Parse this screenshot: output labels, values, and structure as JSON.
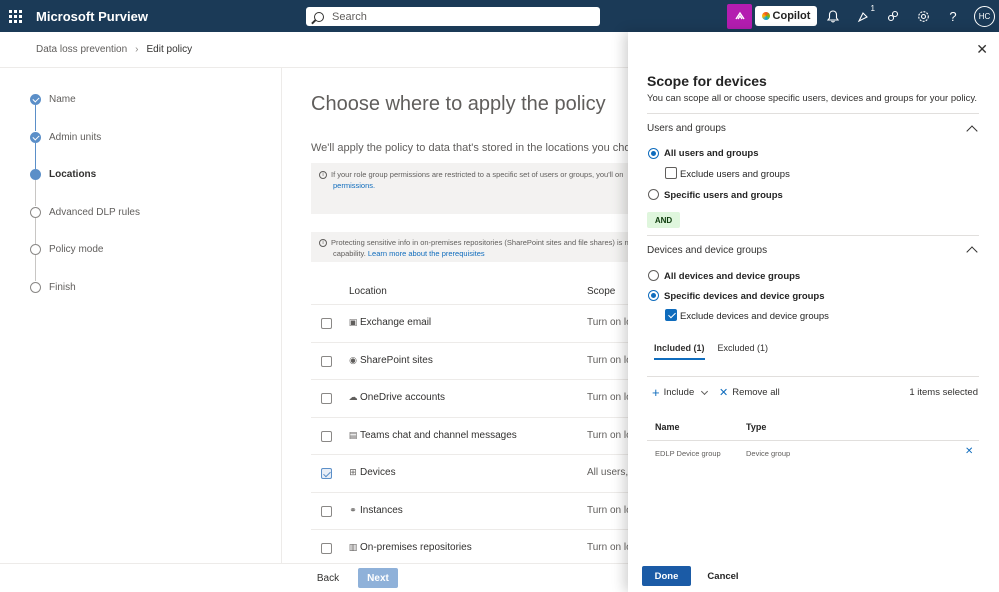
{
  "app": {
    "name": "Microsoft Purview"
  },
  "topbar": {
    "search_placeholder": "Search",
    "copilot_label": "Copilot",
    "notification_count": "1",
    "avatar_initials": "HC",
    "icons": [
      "waffle-icon",
      "purview-icon",
      "bell-icon",
      "link-icon",
      "gear-icon",
      "help-icon"
    ]
  },
  "breadcrumb": {
    "parent": "Data loss prevention",
    "current": "Edit policy"
  },
  "steps": [
    {
      "label": "Name",
      "state": "done"
    },
    {
      "label": "Admin units",
      "state": "done"
    },
    {
      "label": "Locations",
      "state": "active"
    },
    {
      "label": "Advanced DLP rules",
      "state": "pending"
    },
    {
      "label": "Policy mode",
      "state": "pending"
    },
    {
      "label": "Finish",
      "state": "pending"
    }
  ],
  "main": {
    "title": "Choose where to apply the policy",
    "description": "We'll apply the policy to data that's stored in the locations you choose.",
    "info1_line1": "If your role group permissions are restricted to a specific set of users or groups, you'll on",
    "info1_link": "permissions.",
    "info2_line1": "Protecting sensitive info in on-premises repositories (SharePoint sites and file shares) is n",
    "info2_line2": "capability.",
    "info2_link": "Learn more about the prerequisites",
    "table": {
      "col_location": "Location",
      "col_scope": "Scope",
      "rows": [
        {
          "name": "Exchange email",
          "scope": "Turn on lo",
          "checked": false,
          "icon": "exchange-icon"
        },
        {
          "name": "SharePoint sites",
          "scope": "Turn on lo",
          "checked": false,
          "icon": "sharepoint-icon"
        },
        {
          "name": "OneDrive accounts",
          "scope": "Turn on lo",
          "checked": false,
          "icon": "onedrive-icon"
        },
        {
          "name": "Teams chat and channel messages",
          "scope": "Turn on lo",
          "checked": false,
          "icon": "teams-icon"
        },
        {
          "name": "Devices",
          "scope": "All users, g",
          "checked": true,
          "icon": "windows-icon"
        },
        {
          "name": "Instances",
          "scope": "Turn on lo",
          "checked": false,
          "icon": "instances-icon"
        },
        {
          "name": "On-premises repositories",
          "scope": "Turn on lo",
          "checked": false,
          "icon": "server-icon"
        }
      ]
    },
    "back_label": "Back",
    "next_label": "Next"
  },
  "panel": {
    "title": "Scope for devices",
    "description": "You can scope all or choose specific users, devices and groups for your policy.",
    "users_section": {
      "title": "Users and groups",
      "opt_all": "All users and groups",
      "exclude": "Exclude users and groups",
      "opt_specific": "Specific users and groups"
    },
    "and_label": "AND",
    "devices_section": {
      "title": "Devices and device groups",
      "opt_all": "All devices and device groups",
      "opt_specific": "Specific devices and device groups",
      "exclude": "Exclude devices and device groups"
    },
    "tabs": {
      "included": "Included (1)",
      "excluded": "Excluded (1)"
    },
    "toolbar": {
      "include": "Include",
      "remove_all": "Remove all",
      "selected": "1 items selected"
    },
    "table": {
      "col_name": "Name",
      "col_type": "Type",
      "rows": [
        {
          "name": "EDLP Device group",
          "type": "Device group"
        }
      ]
    },
    "done_label": "Done",
    "cancel_label": "Cancel"
  }
}
